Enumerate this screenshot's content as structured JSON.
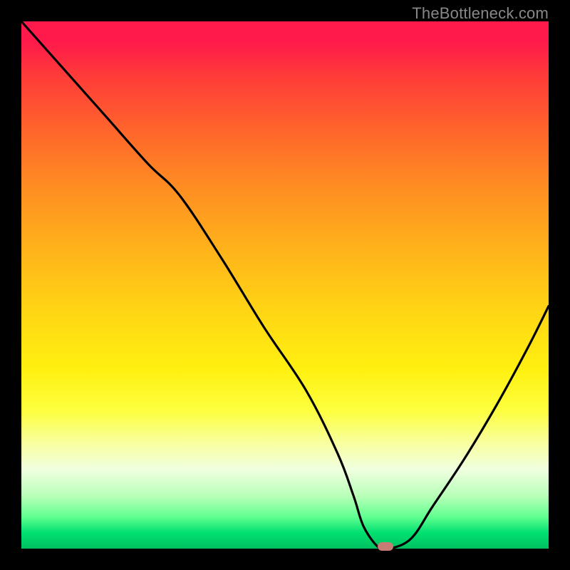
{
  "watermark": "TheBottleneck.com",
  "colors": {
    "frame": "#000000",
    "curve": "#000000",
    "marker": "#c87a74"
  },
  "chart_data": {
    "type": "line",
    "title": "",
    "xlabel": "",
    "ylabel": "",
    "xlim": [
      0,
      100
    ],
    "ylim": [
      0,
      100
    ],
    "grid": false,
    "series": [
      {
        "name": "bottleneck-curve",
        "x": [
          0,
          8,
          16,
          24,
          30,
          38,
          46,
          54,
          60,
          63,
          65,
          68,
          70,
          74,
          78,
          84,
          90,
          96,
          100
        ],
        "values": [
          100,
          91,
          82,
          73,
          67,
          55,
          42,
          30,
          18,
          10,
          4,
          0,
          0,
          2,
          8,
          17,
          27,
          38,
          46
        ]
      }
    ],
    "marker": {
      "x": 69,
      "y": 0
    },
    "gradient_stops": [
      {
        "pos": 0,
        "color": "#ff1a4b"
      },
      {
        "pos": 10,
        "color": "#ff3a3a"
      },
      {
        "pos": 22,
        "color": "#ff6a2a"
      },
      {
        "pos": 32,
        "color": "#ff8f22"
      },
      {
        "pos": 44,
        "color": "#ffb51a"
      },
      {
        "pos": 56,
        "color": "#ffd814"
      },
      {
        "pos": 66,
        "color": "#fff010"
      },
      {
        "pos": 74,
        "color": "#fdff40"
      },
      {
        "pos": 80,
        "color": "#f8ffa0"
      },
      {
        "pos": 85,
        "color": "#f0ffe0"
      },
      {
        "pos": 90,
        "color": "#b8ffb8"
      },
      {
        "pos": 94,
        "color": "#60ff90"
      },
      {
        "pos": 97,
        "color": "#00e070"
      },
      {
        "pos": 100,
        "color": "#00c060"
      }
    ]
  }
}
